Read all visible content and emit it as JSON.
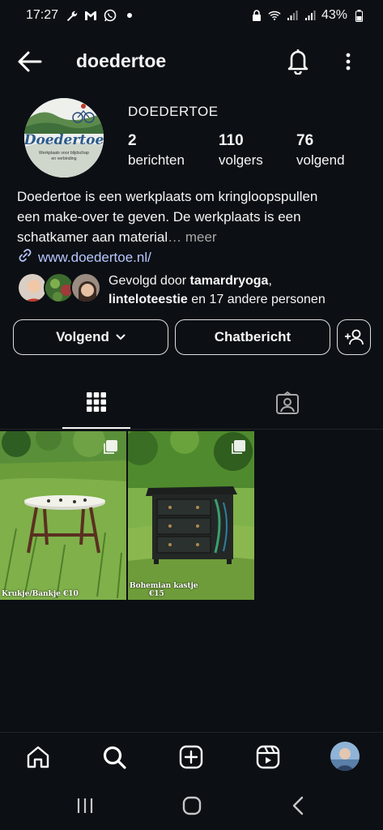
{
  "status_bar": {
    "time": "17:27",
    "battery": "43%"
  },
  "header": {
    "username": "doedertoe"
  },
  "profile": {
    "display_name": "DOEDERTOE",
    "avatar_text": "Doedertoe",
    "avatar_subtext": "Werkplaats voor blijdschap en verbinding",
    "stats": [
      {
        "number": "2",
        "label": "berichten"
      },
      {
        "number": "110",
        "label": "volgers"
      },
      {
        "number": "76",
        "label": "volgend"
      }
    ],
    "bio_line1": "Doedertoe is een werkplaats om kringloopspullen",
    "bio_line2": "een make-over te geven. De werkplaats is een",
    "bio_line3": "schatkamer aan material",
    "bio_more": "… meer",
    "website": "www.doedertoe.nl/",
    "followed_prefix": "Gevolgd door ",
    "followed_user1": "tamardryoga",
    "followed_comma": ",",
    "followed_user2": "linteloteestie",
    "followed_suffix": " en 17 andere personen"
  },
  "buttons": {
    "following": "Volgend",
    "message": "Chatbericht"
  },
  "posts": [
    {
      "caption": "Krukje/Bankje €10"
    },
    {
      "caption_line1": "Bohemian kastje",
      "caption_line2": "€15"
    }
  ],
  "colors": {
    "background": "#0c1014",
    "link": "#b8c6ff",
    "border": "#e0e0e0"
  }
}
